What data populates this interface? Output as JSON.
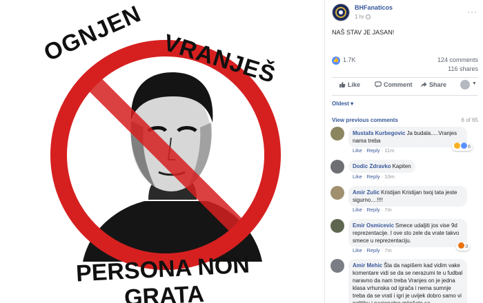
{
  "image": {
    "top_text": [
      "OGNJEN",
      "VRANJEŠ"
    ],
    "bottom_text": "PERSONA NON GRATA",
    "colors": {
      "sign_red": "#d62020",
      "ink": "#111111"
    }
  },
  "post": {
    "page_name": "BHFanaticos",
    "time": "1 hr",
    "text": "NAŠ STAV JE JASAN!",
    "reactions_count": "1.7K",
    "comments_count": "124 comments",
    "shares_count": "116 shares",
    "actions": {
      "like": "Like",
      "comment": "Comment",
      "share": "Share"
    },
    "sort_label": "Oldest ▾",
    "view_previous": "View previous comments",
    "comment_position": "6 of 65"
  },
  "comments": [
    {
      "author": "Mustafa Kurbegovic",
      "text": "Ja budala.....Vranjes nama treba",
      "like": "Like",
      "reply": "Reply",
      "time": "11m",
      "reactions": "6",
      "avatar_color": "#8b8560"
    },
    {
      "author": "Dodic Zdravko",
      "text": "Kapiten",
      "like": "Like",
      "reply": "Reply",
      "time": "10m",
      "reactions": "",
      "avatar_color": "#6d6f73"
    },
    {
      "author": "Amir Zulic",
      "text": "Kristijan Kristijan twoj tata jeste sigurno....!!!!",
      "like": "Like",
      "reply": "Reply",
      "time": "7m",
      "reactions": "",
      "avatar_color": "#a09070"
    },
    {
      "author": "Emir Osmicevic",
      "text": "Smece udaljiti jos vise 9d reprezentacije. I ove sto zele da vrate takvo smece u reprezentaciju.",
      "like": "Like",
      "reply": "Reply",
      "time": "7m",
      "reactions": "3",
      "avatar_color": "#5f6650"
    },
    {
      "author": "Amir Mehic",
      "text": "Šta da napišem kad vidim vake komentare vidi se da se nerazumi te u fudbal naravno da nam treba Vranjes on je jedna klasa vrhunska od igrača i nema sumnje treba da se vrati i igri je uvijek dobro samo vi politiku i nacionalno miješate sa",
      "like": "",
      "reply": "",
      "time": "",
      "reactions": "",
      "avatar_color": "#7a7d84"
    }
  ]
}
